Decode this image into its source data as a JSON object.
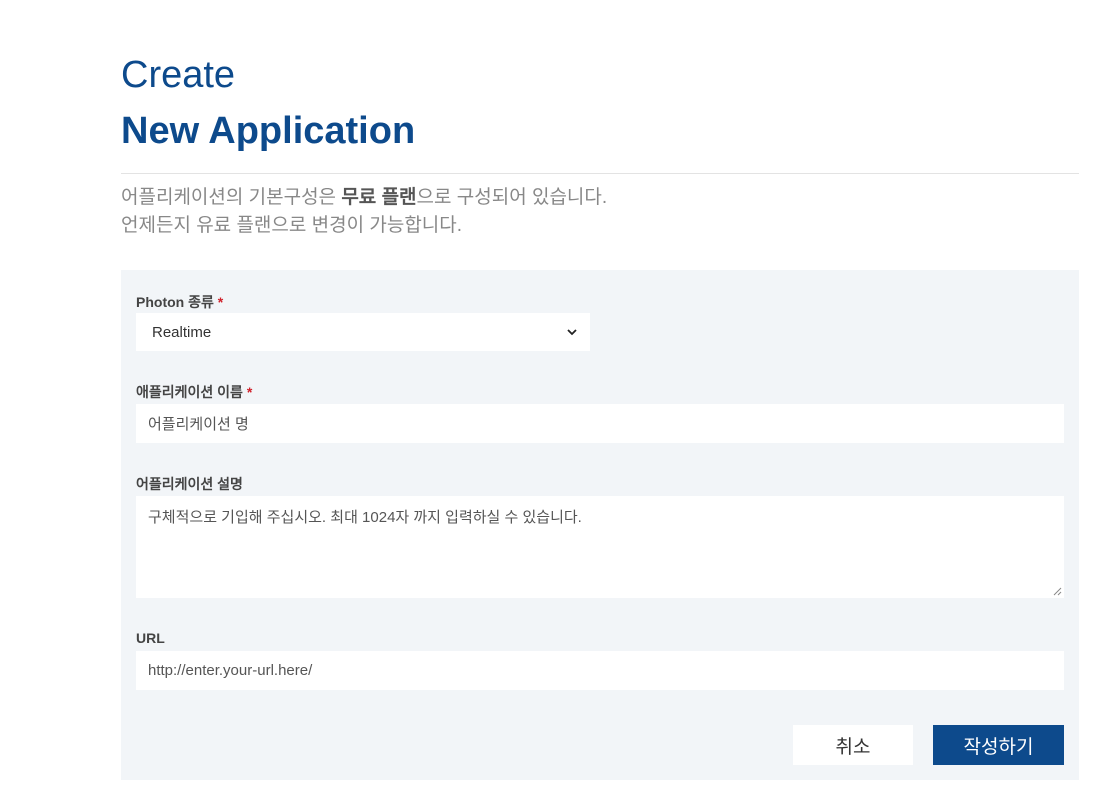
{
  "header": {
    "title_line1": "Create",
    "title_line2": "New Application"
  },
  "intro": {
    "line1_prefix": "어플리케이션의 기본구성은 ",
    "line1_bold": "무료 플랜",
    "line1_suffix": "으로 구성되어 있습니다.",
    "line2": "언제든지 유료 플랜으로 변경이 가능합니다."
  },
  "form": {
    "photon_type": {
      "label": "Photon 종류",
      "required_mark": "*",
      "selected": "Realtime"
    },
    "app_name": {
      "label": "애플리케이션 이름",
      "required_mark": "*",
      "placeholder": "어플리케이션 명"
    },
    "app_description": {
      "label": "어플리케이션 설명",
      "placeholder": "구체적으로 기입해 주십시오. 최대 1024자 까지 입력하실 수 있습니다."
    },
    "url": {
      "label": "URL",
      "placeholder": "http://enter.your-url.here/"
    }
  },
  "actions": {
    "cancel_label": "취소",
    "submit_label": "작성하기"
  },
  "colors": {
    "brand": "#0d4a8c",
    "panel_bg": "#f2f5f8",
    "required": "#d0202a"
  }
}
